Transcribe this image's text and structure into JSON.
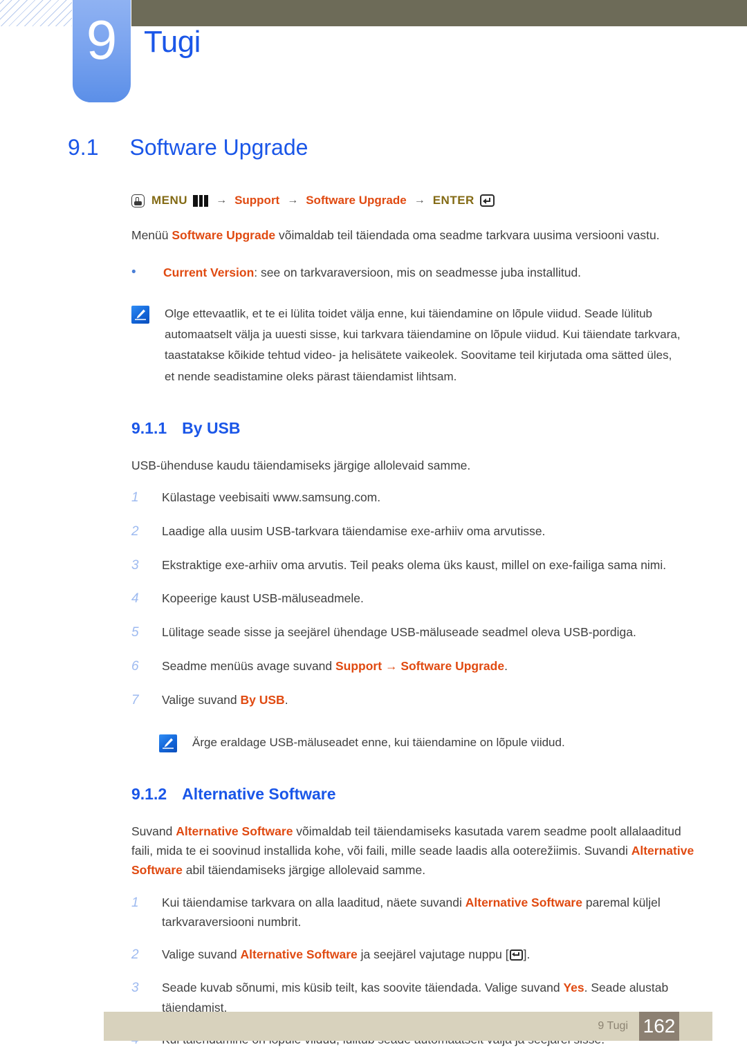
{
  "header": {
    "chapter_number": "9",
    "chapter_title": "Tugi"
  },
  "section": {
    "number": "9.1",
    "title": "Software Upgrade"
  },
  "menu_path": {
    "hand_icon": "hand-press-icon",
    "menu_label": "MENU",
    "menu_bars_icon": "menu-bars-icon",
    "arrow1": "→",
    "support_label": "Support",
    "arrow2": "→",
    "software_upgrade_label": "Software Upgrade",
    "arrow3": "→",
    "enter_label": "ENTER",
    "enter_icon": "enter-key-icon"
  },
  "intro": {
    "text_before": "Menüü ",
    "keyword": "Software Upgrade",
    "text_after": " võimaldab teil täiendada oma seadme tarkvara uusima versiooni vastu."
  },
  "bullet": {
    "marker": "•",
    "keyword": "Current Version",
    "text": ": see on tarkvaraversioon, mis on seadmesse juba installitud."
  },
  "note1": {
    "icon": "note-pencil-icon",
    "text": "Olge ettevaatlik, et te ei lülita toidet välja enne, kui täiendamine on lõpule viidud. Seade lülitub automaatselt välja ja uuesti sisse, kui tarkvara täiendamine on lõpule viidud. Kui täiendate tarkvara, taastatakse kõikide tehtud video- ja helisätete vaikeolek. Soovitame teil kirjutada oma sätted üles, et nende seadistamine oleks pärast täiendamist lihtsam."
  },
  "subsection1": {
    "number": "9.1.1",
    "title": "By USB",
    "intro": "USB-ühenduse kaudu täiendamiseks järgige allolevaid samme.",
    "steps": [
      {
        "num": "1",
        "text": "Külastage veebisaiti www.samsung.com."
      },
      {
        "num": "2",
        "text": "Laadige alla uusim USB-tarkvara täiendamise exe-arhiiv oma arvutisse."
      },
      {
        "num": "3",
        "text": "Ekstraktige exe-arhiiv oma arvutis. Teil peaks olema üks kaust, millel on exe-failiga sama nimi."
      },
      {
        "num": "4",
        "text": "Kopeerige kaust USB-mäluseadmele."
      },
      {
        "num": "5",
        "text": "Lülitage seade sisse ja seejärel ühendage USB-mäluseade seadmel oleva USB-pordiga."
      }
    ],
    "step6": {
      "num": "6",
      "before": "Seadme menüüs avage suvand ",
      "kw1": "Support",
      "arrow": " → ",
      "kw2": "Software Upgrade",
      "after": "."
    },
    "step7": {
      "num": "7",
      "before": "Valige suvand ",
      "kw1": "By USB",
      "after": "."
    },
    "note": {
      "icon": "note-pencil-icon",
      "text": "Ärge eraldage USB-mäluseadet enne, kui täiendamine on lõpule viidud."
    }
  },
  "subsection2": {
    "number": "9.1.2",
    "title": "Alternative Software",
    "intro": {
      "p1": "Suvand ",
      "kw1": "Alternative Software",
      "p2": " võimaldab teil täiendamiseks kasutada varem seadme poolt allalaaditud faili, mida te ei soovinud installida kohe, või faili, mille seade laadis alla ooterežiimis. Suvandi ",
      "kw2": "Alternative Software",
      "p3": " abil täiendamiseks järgige allolevaid samme."
    },
    "step1": {
      "num": "1",
      "before": "Kui täiendamise tarkvara on alla laaditud, näete suvandi ",
      "kw1": "Alternative Software",
      "after": " paremal küljel tarkvaraversiooni numbrit."
    },
    "step2": {
      "num": "2",
      "before": "Valige suvand ",
      "kw1": "Alternative Software",
      "mid": " ja seejärel vajutage nuppu [",
      "icon": "enter-key-icon",
      "after": "]."
    },
    "step3": {
      "num": "3",
      "before": "Seade kuvab sõnumi, mis küsib teilt, kas soovite täiendada. Valige suvand ",
      "kw1": "Yes",
      "after": ". Seade alustab täiendamist."
    },
    "step4": {
      "num": "4",
      "text": "Kui täiendamine on lõpule viidud, lülitub seade automaatselt välja ja seejärel sisse."
    }
  },
  "footer": {
    "label": "9 Tugi",
    "page": "162"
  },
  "colors": {
    "heading_blue": "#1a56e8",
    "keyword_orange": "#e04a11",
    "menu_olive": "#836a14",
    "header_bar": "#6d6b58",
    "footer_bar": "#d8d2bd",
    "footer_page_box": "#8c8072",
    "step_number": "#9dbaf0"
  }
}
